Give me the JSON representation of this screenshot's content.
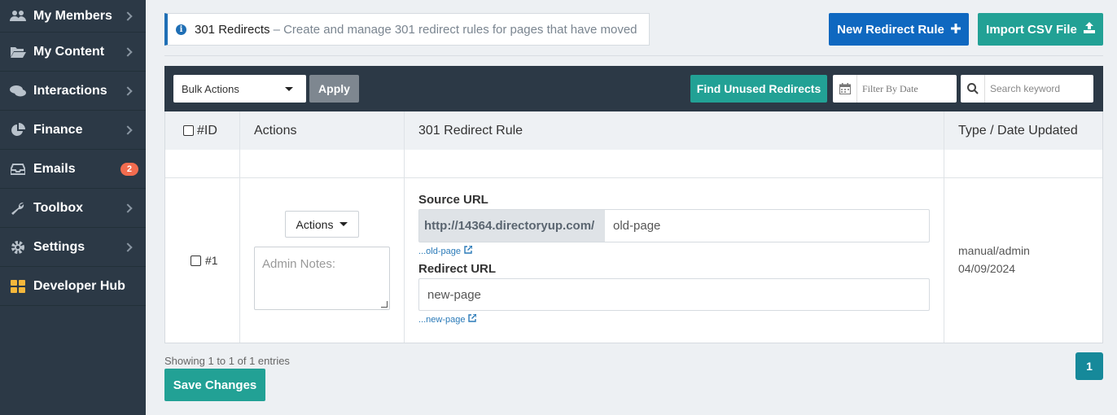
{
  "sidebar": {
    "items": [
      {
        "label": "My Members",
        "icon": "members-icon"
      },
      {
        "label": "My Content",
        "icon": "folder-open-icon"
      },
      {
        "label": "Interactions",
        "icon": "chat-bubbles-icon"
      },
      {
        "label": "Finance",
        "icon": "pie-chart-icon"
      },
      {
        "label": "Emails",
        "icon": "inbox-icon",
        "badge": "2"
      },
      {
        "label": "Toolbox",
        "icon": "wrench-icon"
      },
      {
        "label": "Settings",
        "icon": "gear-icon"
      },
      {
        "label": "Developer Hub",
        "icon": "grid-icon"
      }
    ]
  },
  "header": {
    "title": "301 Redirects",
    "description": "– Create and manage 301 redirect rules for pages that have moved",
    "new_rule_label": "New Redirect Rule",
    "import_label": "Import CSV File"
  },
  "toolbar": {
    "bulk_actions": "Bulk Actions",
    "apply": "Apply",
    "find_unused": "Find Unused Redirects",
    "date_placeholder": "Filter By Date",
    "search_placeholder": "Search keyword"
  },
  "table": {
    "headers": {
      "id": "#ID",
      "actions": "Actions",
      "rule": "301 Redirect Rule",
      "type": "Type / Date Updated"
    },
    "row": {
      "id": "#1",
      "actions_label": "Actions",
      "notes_placeholder": "Admin Notes:",
      "source_label": "Source URL",
      "source_prefix": "http://14364.directoryup.com/",
      "source_value": "old-page",
      "source_link": "...old-page",
      "redirect_label": "Redirect URL",
      "redirect_value": "new-page",
      "redirect_link": "...new-page",
      "type": "manual/admin",
      "date": "04/09/2024"
    }
  },
  "footer": {
    "showing": "Showing 1 to 1 of 1 entries",
    "save": "Save Changes",
    "page": "1"
  },
  "colors": {
    "sidebar": "#2c3946",
    "primary": "#0f68c0",
    "teal": "#22a195",
    "badge": "#f26c4f"
  }
}
